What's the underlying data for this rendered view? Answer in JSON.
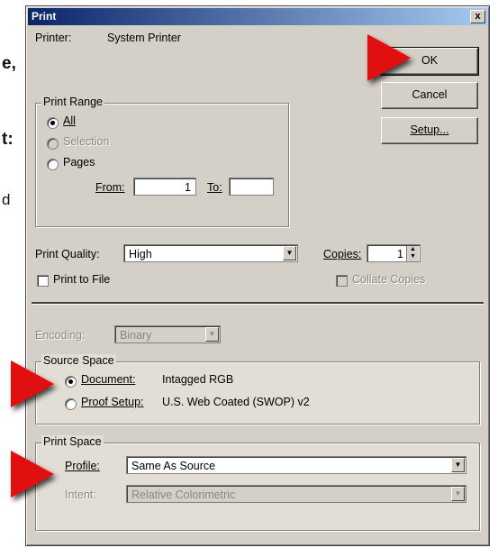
{
  "background_text": {
    "frag_1": "e,",
    "frag_2": "t:",
    "frag_3": "d"
  },
  "dialog": {
    "title": "Print",
    "close_glyph": "x",
    "printer_label": "Printer:",
    "printer_value": "System Printer",
    "ok_label": "OK",
    "cancel_label": "Cancel",
    "setup_label": "Setup...",
    "print_range": {
      "title": "Print Range",
      "all": "All",
      "selection": "Selection",
      "pages": "Pages",
      "from_label": "From:",
      "from_value": "1",
      "to_label": "To:",
      "to_value": ""
    },
    "print_quality_label": "Print Quality:",
    "print_quality_value": "High",
    "copies_label": "Copies:",
    "copies_value": "1",
    "print_to_file": "Print to File",
    "collate_copies": "Collate Copies",
    "encoding_label": "Encoding:",
    "encoding_value": "Binary",
    "source_space": {
      "title": "Source Space",
      "document_label": "Document:",
      "document_value": "Intagged RGB",
      "proof_label": "Proof Setup:",
      "proof_value": "U.S. Web Coated (SWOP) v2"
    },
    "print_space": {
      "title": "Print Space",
      "profile_label": "Profile:",
      "profile_value": "Same As Source",
      "intent_label": "Intent:",
      "intent_value": "Relative Colorimetric"
    }
  },
  "annotation_color": "#e01010"
}
